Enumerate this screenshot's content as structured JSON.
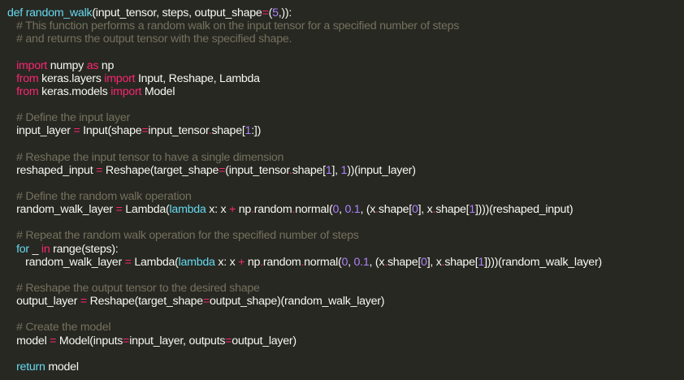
{
  "editor": {
    "lines": [
      {
        "indent": "",
        "tokens": [
          {
            "t": "def",
            "k": "def"
          },
          {
            "t": " ",
            "k": "plain"
          },
          {
            "t": "random_walk",
            "k": "fn"
          },
          {
            "t": "(input_tensor, steps, output_shape",
            "k": "plain"
          },
          {
            "t": "=",
            "k": "op"
          },
          {
            "t": "(",
            "k": "plain"
          },
          {
            "t": "5",
            "k": "num"
          },
          {
            "t": ",)):",
            "k": "plain"
          }
        ]
      },
      {
        "indent": "   ",
        "tokens": [
          {
            "t": "# This function performs a random walk on the input tensor for a specified number of steps",
            "k": "comment"
          }
        ]
      },
      {
        "indent": "   ",
        "tokens": [
          {
            "t": "# and returns the output tensor with the specified shape.",
            "k": "comment"
          }
        ]
      },
      {
        "indent": "",
        "tokens": []
      },
      {
        "indent": "   ",
        "tokens": [
          {
            "t": "import",
            "k": "keyword"
          },
          {
            "t": " numpy ",
            "k": "plain"
          },
          {
            "t": "as",
            "k": "keyword"
          },
          {
            "t": " np",
            "k": "plain"
          }
        ]
      },
      {
        "indent": "   ",
        "tokens": [
          {
            "t": "from",
            "k": "keyword"
          },
          {
            "t": " keras.layers ",
            "k": "plain"
          },
          {
            "t": "import",
            "k": "keyword"
          },
          {
            "t": " Input, Reshape, Lambda",
            "k": "plain"
          }
        ]
      },
      {
        "indent": "   ",
        "tokens": [
          {
            "t": "from",
            "k": "keyword"
          },
          {
            "t": " keras.models ",
            "k": "plain"
          },
          {
            "t": "import",
            "k": "keyword"
          },
          {
            "t": " Model",
            "k": "plain"
          }
        ]
      },
      {
        "indent": "",
        "tokens": []
      },
      {
        "indent": "   ",
        "tokens": [
          {
            "t": "# Define the input layer",
            "k": "comment"
          }
        ]
      },
      {
        "indent": "   ",
        "tokens": [
          {
            "t": "input_layer ",
            "k": "plain"
          },
          {
            "t": "=",
            "k": "op"
          },
          {
            "t": " Input(shape",
            "k": "plain"
          },
          {
            "t": "=",
            "k": "op"
          },
          {
            "t": "input_tensor",
            "k": "plain"
          },
          {
            "t": ".",
            "k": "op"
          },
          {
            "t": "shape[",
            "k": "plain"
          },
          {
            "t": "1",
            "k": "num"
          },
          {
            "t": ":])",
            "k": "plain"
          }
        ]
      },
      {
        "indent": "",
        "tokens": []
      },
      {
        "indent": "   ",
        "tokens": [
          {
            "t": "# Reshape the input tensor to have a single dimension",
            "k": "comment"
          }
        ]
      },
      {
        "indent": "   ",
        "tokens": [
          {
            "t": "reshaped_input ",
            "k": "plain"
          },
          {
            "t": "=",
            "k": "op"
          },
          {
            "t": " Reshape(target_shape",
            "k": "plain"
          },
          {
            "t": "=",
            "k": "op"
          },
          {
            "t": "(input_tensor",
            "k": "plain"
          },
          {
            "t": ".",
            "k": "op"
          },
          {
            "t": "shape[",
            "k": "plain"
          },
          {
            "t": "1",
            "k": "num"
          },
          {
            "t": "], ",
            "k": "plain"
          },
          {
            "t": "1",
            "k": "num"
          },
          {
            "t": "))(input_layer)",
            "k": "plain"
          }
        ]
      },
      {
        "indent": "",
        "tokens": []
      },
      {
        "indent": "   ",
        "tokens": [
          {
            "t": "# Define the random walk operation",
            "k": "comment"
          }
        ]
      },
      {
        "indent": "   ",
        "tokens": [
          {
            "t": "random_walk_layer ",
            "k": "plain"
          },
          {
            "t": "=",
            "k": "op"
          },
          {
            "t": " Lambda(",
            "k": "plain"
          },
          {
            "t": "lambda",
            "k": "def"
          },
          {
            "t": " x: x ",
            "k": "plain"
          },
          {
            "t": "+",
            "k": "op"
          },
          {
            "t": " np",
            "k": "plain"
          },
          {
            "t": ".",
            "k": "op"
          },
          {
            "t": "random",
            "k": "plain"
          },
          {
            "t": ".",
            "k": "op"
          },
          {
            "t": "normal(",
            "k": "plain"
          },
          {
            "t": "0",
            "k": "num"
          },
          {
            "t": ", ",
            "k": "plain"
          },
          {
            "t": "0.1",
            "k": "num"
          },
          {
            "t": ", (x",
            "k": "plain"
          },
          {
            "t": ".",
            "k": "op"
          },
          {
            "t": "shape[",
            "k": "plain"
          },
          {
            "t": "0",
            "k": "num"
          },
          {
            "t": "], x",
            "k": "plain"
          },
          {
            "t": ".",
            "k": "op"
          },
          {
            "t": "shape[",
            "k": "plain"
          },
          {
            "t": "1",
            "k": "num"
          },
          {
            "t": "])))(reshaped_input)",
            "k": "plain"
          }
        ]
      },
      {
        "indent": "",
        "tokens": []
      },
      {
        "indent": "   ",
        "tokens": [
          {
            "t": "# Repeat the random walk operation for the specified number of steps",
            "k": "comment"
          }
        ]
      },
      {
        "indent": "   ",
        "tokens": [
          {
            "t": "for",
            "k": "def"
          },
          {
            "t": " _ ",
            "k": "plain"
          },
          {
            "t": "in",
            "k": "keyword"
          },
          {
            "t": " range(steps):",
            "k": "plain"
          }
        ]
      },
      {
        "indent": "      ",
        "tokens": [
          {
            "t": "random_walk_layer ",
            "k": "plain"
          },
          {
            "t": "=",
            "k": "op"
          },
          {
            "t": " Lambda(",
            "k": "plain"
          },
          {
            "t": "lambda",
            "k": "def"
          },
          {
            "t": " x: x ",
            "k": "plain"
          },
          {
            "t": "+",
            "k": "op"
          },
          {
            "t": " np",
            "k": "plain"
          },
          {
            "t": ".",
            "k": "op"
          },
          {
            "t": "random",
            "k": "plain"
          },
          {
            "t": ".",
            "k": "op"
          },
          {
            "t": "normal(",
            "k": "plain"
          },
          {
            "t": "0",
            "k": "num"
          },
          {
            "t": ", ",
            "k": "plain"
          },
          {
            "t": "0.1",
            "k": "num"
          },
          {
            "t": ", (x",
            "k": "plain"
          },
          {
            "t": ".",
            "k": "op"
          },
          {
            "t": "shape[",
            "k": "plain"
          },
          {
            "t": "0",
            "k": "num"
          },
          {
            "t": "], x",
            "k": "plain"
          },
          {
            "t": ".",
            "k": "op"
          },
          {
            "t": "shape[",
            "k": "plain"
          },
          {
            "t": "1",
            "k": "num"
          },
          {
            "t": "])))(random_walk_layer)",
            "k": "plain"
          }
        ]
      },
      {
        "indent": "",
        "tokens": []
      },
      {
        "indent": "   ",
        "tokens": [
          {
            "t": "# Reshape the output tensor to the desired shape",
            "k": "comment"
          }
        ]
      },
      {
        "indent": "   ",
        "tokens": [
          {
            "t": "output_layer ",
            "k": "plain"
          },
          {
            "t": "=",
            "k": "op"
          },
          {
            "t": " Reshape(target_shape",
            "k": "plain"
          },
          {
            "t": "=",
            "k": "op"
          },
          {
            "t": "output_shape)(random_walk_layer)",
            "k": "plain"
          }
        ]
      },
      {
        "indent": "",
        "tokens": []
      },
      {
        "indent": "   ",
        "tokens": [
          {
            "t": "# Create the model",
            "k": "comment"
          }
        ]
      },
      {
        "indent": "   ",
        "tokens": [
          {
            "t": "model ",
            "k": "plain"
          },
          {
            "t": "=",
            "k": "op"
          },
          {
            "t": " Model(inputs",
            "k": "plain"
          },
          {
            "t": "=",
            "k": "op"
          },
          {
            "t": "input_layer, outputs",
            "k": "plain"
          },
          {
            "t": "=",
            "k": "op"
          },
          {
            "t": "output_layer)",
            "k": "plain"
          }
        ]
      },
      {
        "indent": "",
        "tokens": []
      },
      {
        "indent": "   ",
        "tokens": [
          {
            "t": "return",
            "k": "def"
          },
          {
            "t": " model",
            "k": "plain"
          }
        ]
      }
    ]
  },
  "theme": {
    "background": "#272822",
    "keyword": "#f92672",
    "def": "#66d9ef",
    "number": "#ae81ff",
    "comment": "#75715e",
    "text": "#f8f8f2"
  }
}
